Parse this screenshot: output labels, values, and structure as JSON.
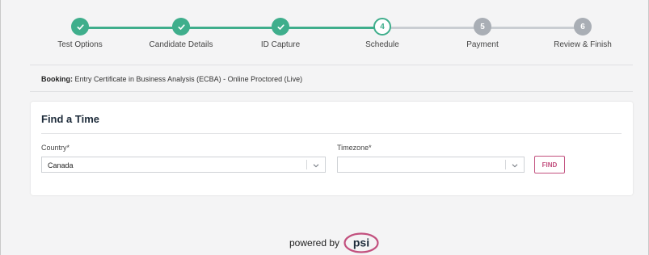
{
  "stepper": {
    "steps": [
      {
        "label": "Test Options",
        "state": "done",
        "marker": "✓"
      },
      {
        "label": "Candidate Details",
        "state": "done",
        "marker": "✓"
      },
      {
        "label": "ID Capture",
        "state": "done",
        "marker": "✓"
      },
      {
        "label": "Schedule",
        "state": "current",
        "marker": "4"
      },
      {
        "label": "Payment",
        "state": "todo",
        "marker": "5"
      },
      {
        "label": "Review & Finish",
        "state": "todo",
        "marker": "6"
      }
    ],
    "colors": {
      "done": "#3fae8c",
      "todo": "#a9aeb5"
    }
  },
  "booking": {
    "label": "Booking:",
    "value": "Entry Certificate in Business Analysis (ECBA) - Online Proctored (Live)"
  },
  "find_time": {
    "title": "Find a Time",
    "country": {
      "label": "Country*",
      "value": "Canada"
    },
    "timezone": {
      "label": "Timezone*",
      "value": ""
    },
    "find_button": "FIND"
  },
  "footer": {
    "powered_by": "powered by",
    "brand": "psi",
    "brand_color": "#c2507e"
  },
  "icons": {
    "check": "check-icon",
    "chevron": "chevron-down-icon"
  }
}
